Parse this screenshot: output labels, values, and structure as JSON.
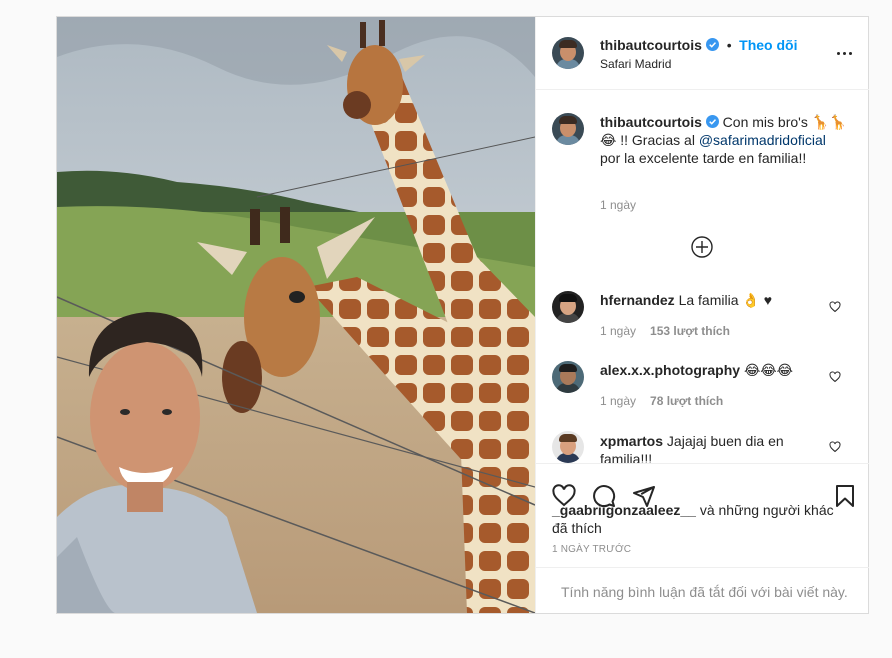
{
  "post": {
    "author": "thibautcourtois",
    "follow_label": "Theo dõi",
    "location": "Safari Madrid",
    "photo_alt": "Selfie with two giraffes at Safari Madrid"
  },
  "caption": {
    "author": "thibautcourtois",
    "text_1": "Con mis bro's 🦒🦒",
    "text_2": "😂 !! Gracias al ",
    "mention": "@safarimadridoficial",
    "text_3": "por la excelente tarde en familia!!",
    "time": "1 ngày"
  },
  "comments": [
    {
      "user": "hfernandez",
      "text": "La familia 👌 ♥",
      "time": "1 ngày",
      "likes": "153 lượt thích"
    },
    {
      "user": "alex.x.x.photography",
      "text": "😂😂😂",
      "time": "1 ngày",
      "likes": "78 lượt thích"
    },
    {
      "user": "xpmartos",
      "text": "Jajajaj buen dia en familia!!!",
      "time": "",
      "likes": ""
    }
  ],
  "likes": {
    "user": "_gaabriigonzaaleez__",
    "rest": " và những người khác đã thích"
  },
  "timestamp": "1 NGÀY TRƯỚC",
  "comments_disabled": "Tính năng bình luận đã tắt đối với bài viết này.",
  "colors": {
    "accent": "#0095f6",
    "mention": "#00376b",
    "muted": "#8e8e8e",
    "border": "#dbdbdb"
  }
}
